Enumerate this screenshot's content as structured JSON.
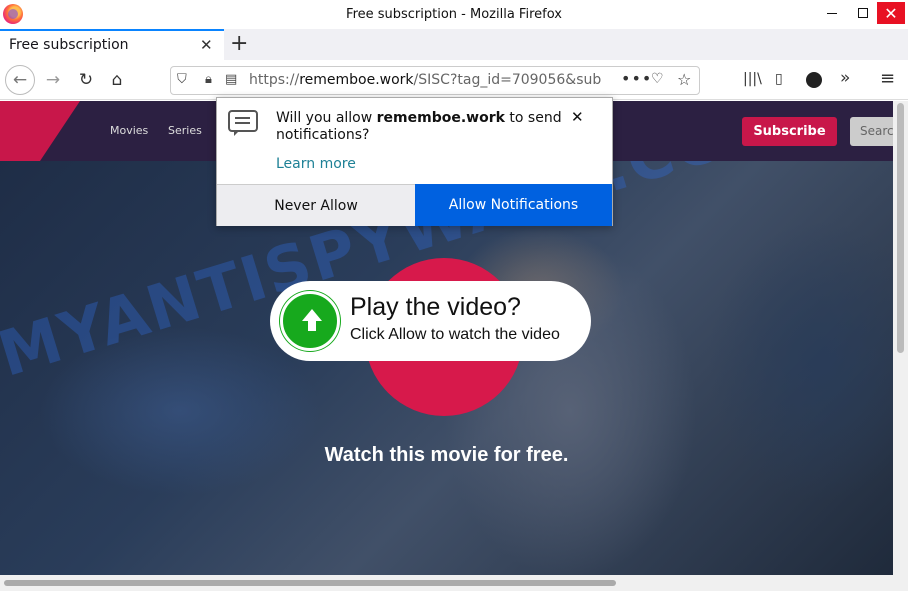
{
  "window": {
    "title": "Free subscription - Mozilla Firefox",
    "minimize": "",
    "maximize": "",
    "close": "✕"
  },
  "tab": {
    "label": "Free subscription",
    "close": "✕",
    "new_tab": "+"
  },
  "nav": {
    "back": "←",
    "forward": "→",
    "reload": "↻",
    "home": "⌂",
    "url_prefix": "https://",
    "url_domain": "rememboe.work",
    "url_path": "/SISC?tag_id=709056&sub",
    "more": "•••",
    "pocket": "♡",
    "star": "☆",
    "library": "|||\\",
    "sidebar": "▯",
    "overflow": "»",
    "menu": "≡"
  },
  "site": {
    "nav_movies": "Movies",
    "nav_series": "Series",
    "subscribe": "Subscribe",
    "search": "Searc",
    "watermark": "MYANTISPYWARE.COM",
    "play_title": "Play the video?",
    "play_sub": "Click Allow to watch the video",
    "watch_free": "Watch this movie for free."
  },
  "popup": {
    "text_pre": "Will you allow ",
    "domain": "rememboe.work",
    "text_post": " to send notifications?",
    "close": "✕",
    "learn_more": "Learn more",
    "never_allow": "Never Allow",
    "allow": "Allow Notifications"
  }
}
